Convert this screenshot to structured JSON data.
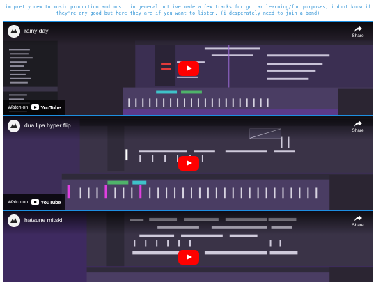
{
  "post": {
    "text": "im pretty new to music production and music in general but ive made a few tracks for guitar learning/fun purposes, i dont know if they're any good but here they are if you want to listen. (i desperately need to join a band)"
  },
  "videos": [
    {
      "title": "rainy day",
      "share_label": "Share",
      "watch_on_label": "Watch on",
      "platform_label": "YouTube"
    },
    {
      "title": "dua lipa hyper flip",
      "share_label": "Share",
      "watch_on_label": "Watch on",
      "platform_label": "YouTube"
    },
    {
      "title": "hatsune mitski",
      "share_label": "Share"
    }
  ],
  "colors": {
    "embed_border": "#1d8fe0",
    "header_text": "#2f93d6",
    "play_button": "#ff0000",
    "daw_purple": "#5b3a8a"
  }
}
